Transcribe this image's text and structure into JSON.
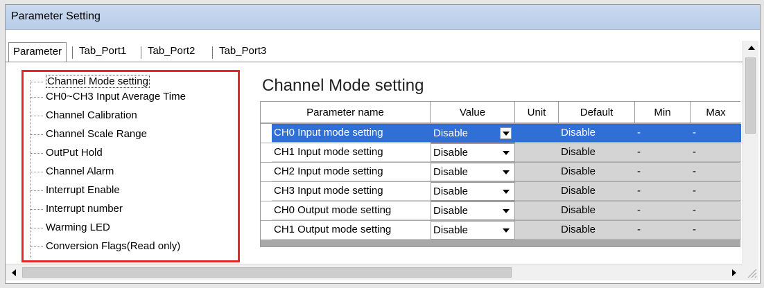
{
  "window": {
    "title": "Parameter Setting"
  },
  "tabs": [
    {
      "label": "Parameter",
      "active": true
    },
    {
      "label": "Tab_Port1",
      "active": false
    },
    {
      "label": "Tab_Port2",
      "active": false
    },
    {
      "label": "Tab_Port3",
      "active": false
    }
  ],
  "tree": {
    "items": [
      {
        "label": "Channel Mode setting",
        "selected": true
      },
      {
        "label": "CH0~CH3 Input Average Time"
      },
      {
        "label": "Channel Calibration"
      },
      {
        "label": "Channel Scale Range"
      },
      {
        "label": "OutPut Hold"
      },
      {
        "label": "Channel Alarm"
      },
      {
        "label": "Interrupt Enable"
      },
      {
        "label": "Interrupt number"
      },
      {
        "label": "Warming LED"
      },
      {
        "label": "Conversion Flags(Read only)"
      }
    ]
  },
  "pane": {
    "title": "Channel Mode setting",
    "columns": [
      "Parameter name",
      "Value",
      "Unit",
      "Default",
      "Min",
      "Max"
    ],
    "rows": [
      {
        "name": "CH0 Input mode setting",
        "value": "Disable",
        "unit": "",
        "default": "Disable",
        "min": "-",
        "max": "-",
        "selected": true
      },
      {
        "name": "CH1 Input mode setting",
        "value": "Disable",
        "unit": "",
        "default": "Disable",
        "min": "-",
        "max": "-"
      },
      {
        "name": "CH2 Input mode setting",
        "value": "Disable",
        "unit": "",
        "default": "Disable",
        "min": "-",
        "max": "-"
      },
      {
        "name": "CH3 Input mode setting",
        "value": "Disable",
        "unit": "",
        "default": "Disable",
        "min": "-",
        "max": "-"
      },
      {
        "name": "CH0 Output mode setting",
        "value": "Disable",
        "unit": "",
        "default": "Disable",
        "min": "-",
        "max": "-"
      },
      {
        "name": "CH1 Output mode setting",
        "value": "Disable",
        "unit": "",
        "default": "Disable",
        "min": "-",
        "max": "-"
      }
    ]
  },
  "colors": {
    "selection": "#2f6fd6",
    "highlight_border": "#e8262a",
    "titlebar": "#c9daf0",
    "readonly_cell": "#d4d4d4"
  },
  "icons": {
    "dropdown": "chevron-down-icon",
    "scroll_up": "arrow-up-icon",
    "scroll_down": "arrow-down-icon",
    "scroll_left": "arrow-left-icon",
    "scroll_right": "arrow-right-icon",
    "resize_grip": "resize-grip-icon"
  }
}
